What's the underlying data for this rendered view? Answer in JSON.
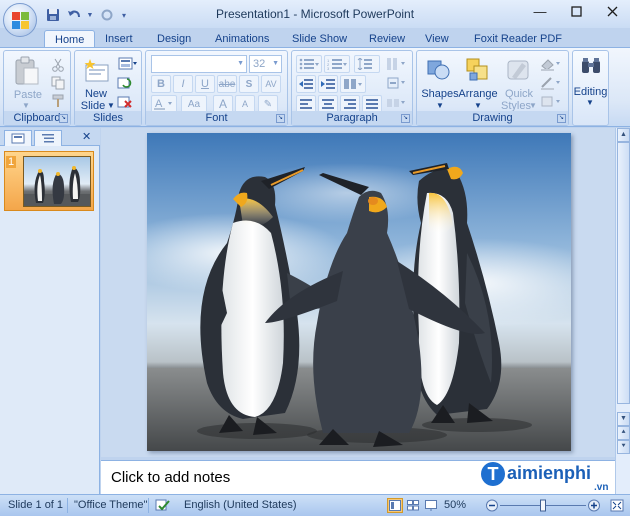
{
  "window": {
    "title": "Presentation1 - Microsoft PowerPoint",
    "controls": [
      "minimize-icon",
      "maximize-icon",
      "close-icon"
    ]
  },
  "quick_access": [
    "save-icon",
    "undo-icon",
    "redo-icon",
    "customize-qat-icon"
  ],
  "tabs": [
    {
      "label": "Home",
      "active": true
    },
    {
      "label": "Insert",
      "active": false
    },
    {
      "label": "Design",
      "active": false
    },
    {
      "label": "Animations",
      "active": false
    },
    {
      "label": "Slide Show",
      "active": false
    },
    {
      "label": "Review",
      "active": false
    },
    {
      "label": "View",
      "active": false
    },
    {
      "label": "Foxit Reader PDF",
      "active": false
    }
  ],
  "ribbon": {
    "clipboard": {
      "label": "Clipboard",
      "paste": "Paste"
    },
    "slides": {
      "label": "Slides",
      "new_slide_line1": "New",
      "new_slide_line2": "Slide"
    },
    "font": {
      "label": "Font",
      "font_name": "",
      "font_size": "32"
    },
    "paragraph": {
      "label": "Paragraph"
    },
    "drawing": {
      "label": "Drawing",
      "shapes": "Shapes",
      "arrange": "Arrange",
      "quick_styles_line1": "Quick",
      "quick_styles_line2": "Styles"
    },
    "editing": {
      "label": "Editing"
    }
  },
  "slides_pane": {
    "tabs": [
      "slides-tab-icon",
      "outline-tab-icon"
    ],
    "slide_number": "1"
  },
  "notes": {
    "placeholder": "Click to add notes"
  },
  "watermark": {
    "brand": "aimienphi",
    "brand_initial": "T",
    "suffix": ".vn"
  },
  "status": {
    "slide": "Slide 1 of 1",
    "theme": "\"Office Theme\"",
    "language": "English (United States)",
    "zoom": "50%",
    "zoom_level": 0.5
  },
  "colors": {
    "ribbon_text": "#15428b",
    "selection_orange": "#f4a64a",
    "brand_blue": "#1b60b8"
  }
}
